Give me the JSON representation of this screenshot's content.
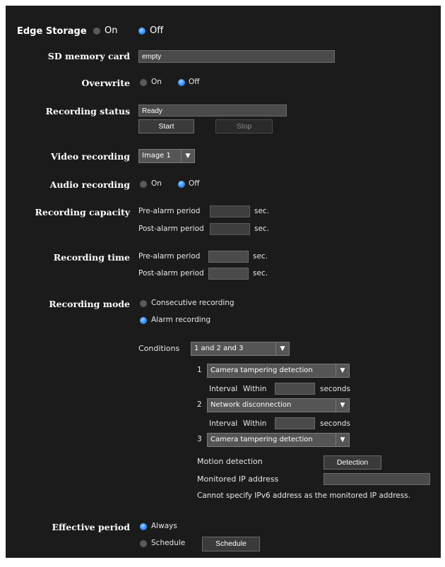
{
  "edge_storage": {
    "title": "Edge Storage",
    "on_label": "On",
    "off_label": "Off",
    "selected": "Off"
  },
  "sd_card": {
    "label": "SD memory card",
    "value": "empty"
  },
  "overwrite": {
    "label": "Overwrite",
    "on_label": "On",
    "off_label": "Off",
    "selected": "Off"
  },
  "recording_status": {
    "label": "Recording status",
    "value": "Ready",
    "start_label": "Start",
    "stop_label": "Stop"
  },
  "video_recording": {
    "label": "Video recording",
    "selected": "Image 1"
  },
  "audio_recording": {
    "label": "Audio recording",
    "on_label": "On",
    "off_label": "Off",
    "selected": "Off"
  },
  "recording_capacity": {
    "label": "Recording capacity",
    "pre_label": "Pre-alarm period",
    "post_label": "Post-alarm period",
    "unit": "sec."
  },
  "recording_time": {
    "label": "Recording time",
    "pre_label": "Pre-alarm period",
    "post_label": "Post-alarm period",
    "unit": "sec."
  },
  "recording_mode": {
    "label": "Recording mode",
    "consecutive_label": "Consecutive recording",
    "alarm_label": "Alarm recording",
    "selected": "Alarm recording",
    "conditions_label": "Conditions",
    "conditions_value": "1 and 2 and 3",
    "conditions": [
      {
        "num": "1",
        "value": "Camera tampering detection"
      },
      {
        "num": "2",
        "value": "Network disconnection"
      },
      {
        "num": "3",
        "value": "Camera tampering detection"
      }
    ],
    "interval_label": "Interval",
    "within_label": "Within",
    "seconds_label": "seconds",
    "motion_label": "Motion detection",
    "detection_button": "Detection",
    "monitored_ip_label": "Monitored IP address",
    "ipv6_note": "Cannot specify IPv6 address as the monitored IP address."
  },
  "effective_period": {
    "label": "Effective period",
    "always_label": "Always",
    "schedule_label": "Schedule",
    "schedule_button": "Schedule",
    "selected": "Always"
  },
  "icons": {
    "dropdown": "chevron-down-icon",
    "radio_selected_color": "#2f8fff",
    "radio_unselected_color": "#5a5a5a"
  }
}
